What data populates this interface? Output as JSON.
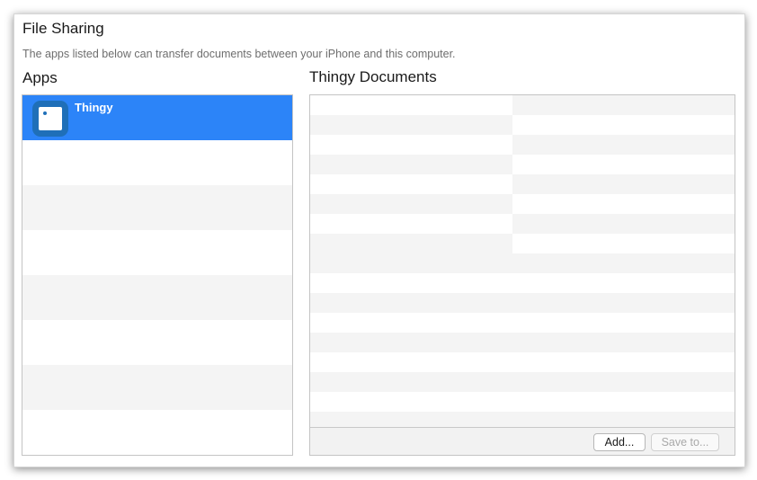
{
  "header": {
    "title": "File Sharing",
    "description": "The apps listed below can transfer documents between your iPhone and this computer."
  },
  "apps": {
    "label": "Apps",
    "items": [
      {
        "name": "Thingy",
        "selected": true,
        "icon": "app-icon"
      }
    ]
  },
  "documents": {
    "label": "Thingy Documents",
    "add_label": "Add...",
    "save_label": "Save to..."
  },
  "colors": {
    "selection": "#2c84f8",
    "app_icon": "#1f6fb8",
    "row_alt": "#f4f4f4"
  }
}
